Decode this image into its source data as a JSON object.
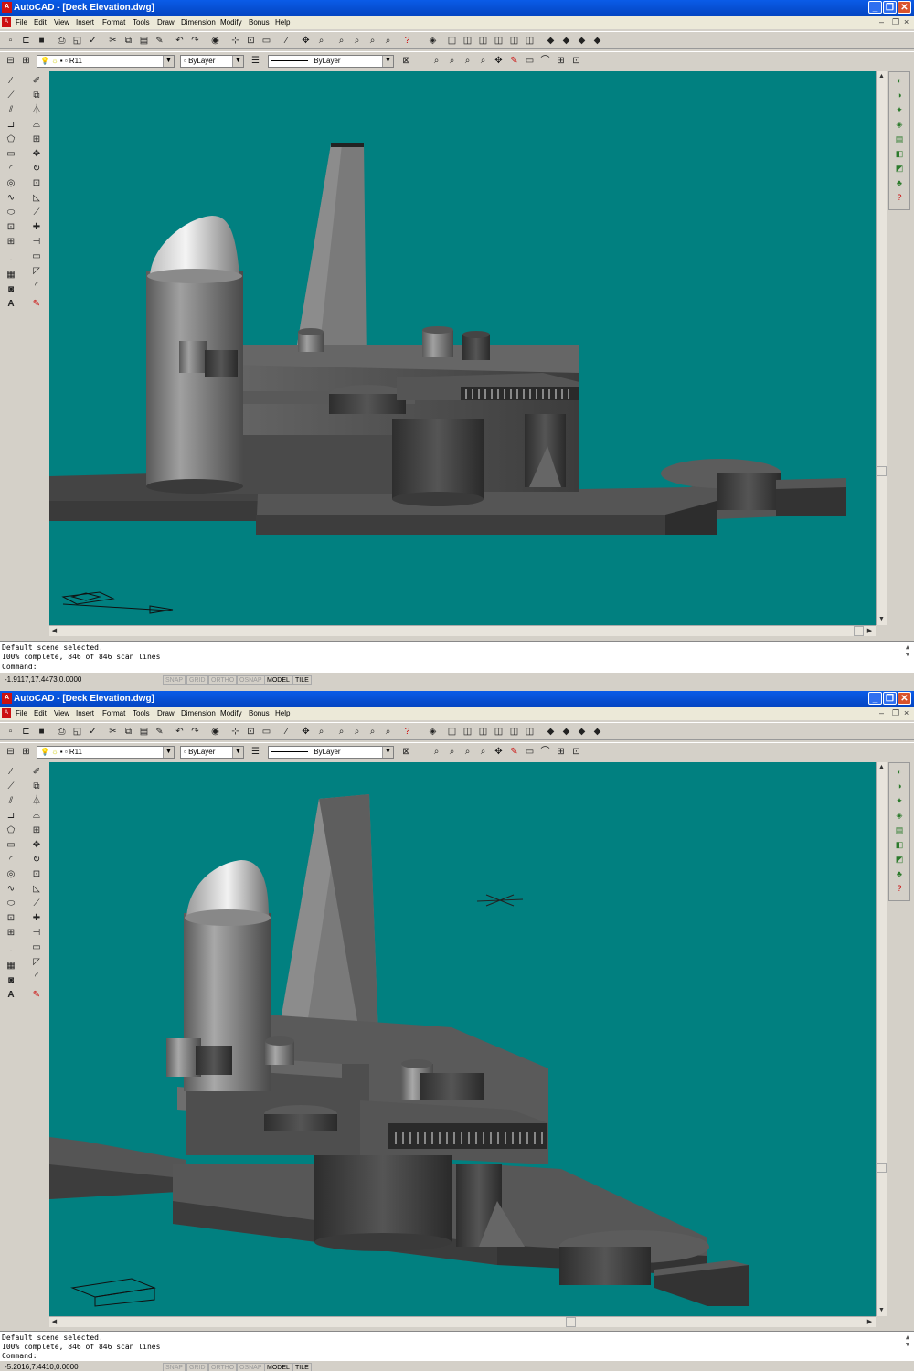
{
  "windows": [
    {
      "title": "AutoCAD - [Deck Elevation.dwg]",
      "menu": [
        "File",
        "Edit",
        "View",
        "Insert",
        "Format",
        "Tools",
        "Draw",
        "Dimension",
        "Modify",
        "Bonus",
        "Help"
      ],
      "layer": "R11",
      "color": "ByLayer",
      "linetype": "ByLayer",
      "command_lines": [
        "Default scene selected.",
        "100% complete, 846 of 846 scan lines",
        "Command:"
      ],
      "coordinates": "-1.9117,17.4473,0.0000",
      "status_buttons": [
        "SNAP",
        "GRID",
        "ORTHO",
        "OSNAP",
        "MODEL",
        "TILE"
      ]
    },
    {
      "title": "AutoCAD - [Deck Elevation.dwg]",
      "menu": [
        "File",
        "Edit",
        "View",
        "Insert",
        "Format",
        "Tools",
        "Draw",
        "Dimension",
        "Modify",
        "Bonus",
        "Help"
      ],
      "layer": "R11",
      "color": "ByLayer",
      "linetype": "ByLayer",
      "command_lines": [
        "Default scene selected.",
        "100% complete, 846 of 846 scan lines",
        "Command:"
      ],
      "coordinates": "-5.2016,7.4410,0.0000",
      "status_buttons": [
        "SNAP",
        "GRID",
        "ORTHO",
        "OSNAP",
        "MODEL",
        "TILE"
      ]
    }
  ],
  "colors": {
    "viewport_bg": "#018080",
    "titlebar": "#0a5ce8",
    "chrome": "#d4d0c8"
  },
  "icons": {
    "minimize": "minimize-icon",
    "restore": "restore-icon",
    "close": "close-icon"
  }
}
